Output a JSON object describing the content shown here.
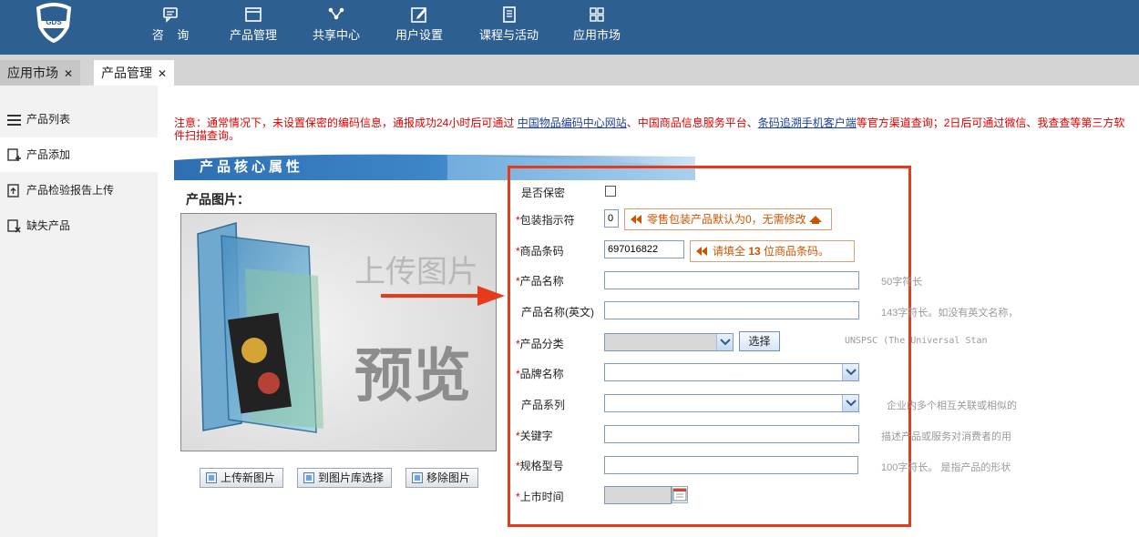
{
  "app": {
    "logo_text": "GDS"
  },
  "nav": [
    {
      "label": "咨    询",
      "icon": "chat-icon"
    },
    {
      "label": "产品管理",
      "icon": "window-icon"
    },
    {
      "label": "共享中心",
      "icon": "share-icon"
    },
    {
      "label": "用户设置",
      "icon": "edit-icon"
    },
    {
      "label": "课程与活动",
      "icon": "document-icon"
    },
    {
      "label": "应用市场",
      "icon": "grid-icon"
    }
  ],
  "tabs": [
    {
      "label": "应用市场",
      "close": "✕",
      "active": false
    },
    {
      "label": "产品管理",
      "close": "✕",
      "active": true
    }
  ],
  "sidebar": {
    "items": [
      {
        "label": "产品列表",
        "icon": "list-icon"
      },
      {
        "label": "产品添加",
        "icon": "add-icon"
      },
      {
        "label": "产品检验报告上传",
        "icon": "upload-icon"
      },
      {
        "label": "缺失产品",
        "icon": "missing-icon"
      }
    ]
  },
  "notice": {
    "prefix": "注意：通常情况下，未设置保密的编码信息，通报成功24小时后可通过 ",
    "link1": "中国物品编码中心网站",
    "middle": "、中国商品信息服务平台、",
    "link2": "条码追溯手机客户端",
    "suffix": "等官方渠道查询；2日后可通过微信、我查查等第三方软件扫描查询。"
  },
  "section": {
    "title": "产品核心属性"
  },
  "image_panel": {
    "label": "产品图片：",
    "preview_text_1": "上传图片",
    "preview_text_2": "预览",
    "buttons": {
      "upload": "上传新图片",
      "library": "到图片库选择",
      "remove": "移除图片"
    }
  },
  "form": {
    "confidential_label": "是否保密",
    "confidential_checked": false,
    "package_label": "包装指示符",
    "package_value": "0",
    "package_hint": "零售包装产品默认为0，无需修改",
    "barcode_label": "商品条码",
    "barcode_value": "697016822",
    "barcode_hint_prefix": "请填全 ",
    "barcode_hint_num": "13",
    "barcode_hint_suffix": " 位商品条码。",
    "name_label": "产品名称",
    "name_hint": "50字符长",
    "name_en_label": "产品名称(英文)",
    "name_en_hint": "143字符长。如没有英文名称，",
    "category_label": "产品分类",
    "category_button": "选择",
    "category_hint": "UNSPSC (The Universal Stan",
    "brand_label": "品牌名称",
    "series_label": "产品系列",
    "series_hint": "企业内多个相互关联或相似的",
    "keyword_label": "关键字",
    "keyword_hint": "描述产品或服务对消费者的用",
    "spec_label": "规格型号",
    "spec_hint": "100字符长。 是指产品的形状",
    "launch_label": "上市时间",
    "required_mark": "*"
  },
  "colors": {
    "topbar": "#2e5f91",
    "highlight": "#e53b1c",
    "required": "#e00000",
    "hint": "#cc5400"
  }
}
